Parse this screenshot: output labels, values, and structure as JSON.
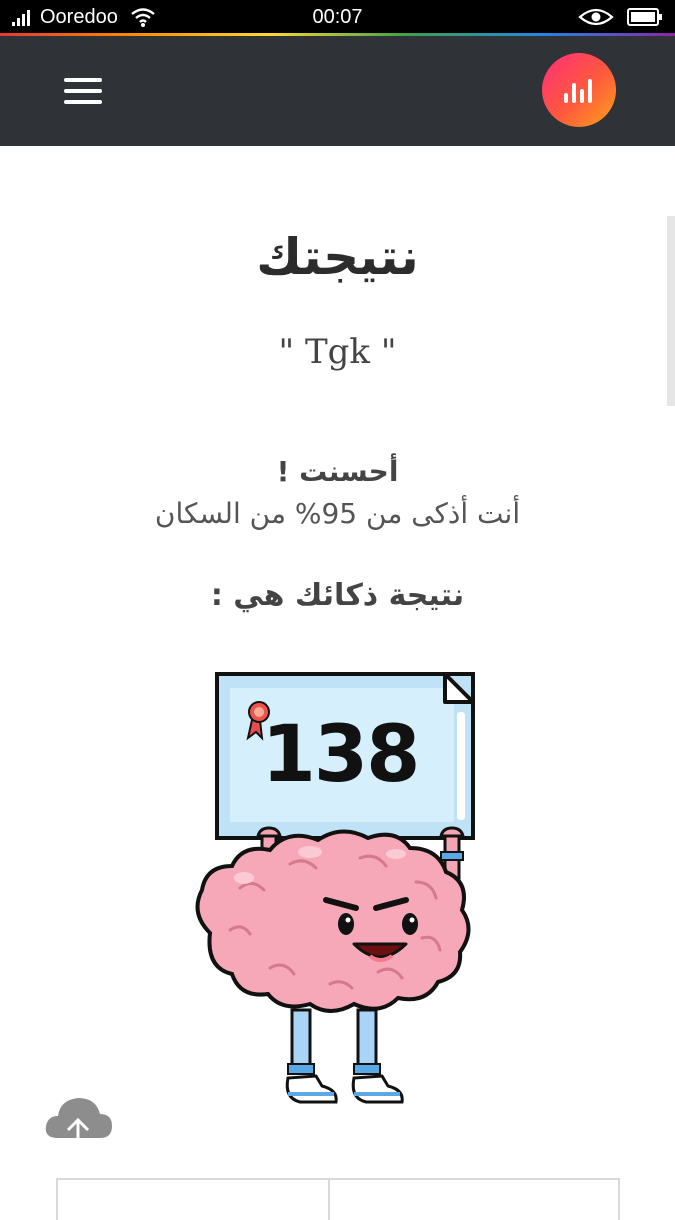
{
  "status_bar": {
    "carrier": "Ooredoo",
    "time": "00:07"
  },
  "header": {
    "menu_icon": "hamburger-menu-icon",
    "logo_icon": "equalizer-logo-icon",
    "logo_colors": [
      "#ff2d7a",
      "#ff5a3c",
      "#ffa21a"
    ]
  },
  "result": {
    "title": "نتيجتك",
    "username": "\" Tgk \"",
    "well_done": "أحسنت !",
    "smarter_than": "أنت أذكى من 95% من السكان",
    "iq_label": "نتيجة ذكائك هي :",
    "iq_score": "138"
  },
  "footer": {
    "upload_icon": "cloud-upload-icon"
  }
}
